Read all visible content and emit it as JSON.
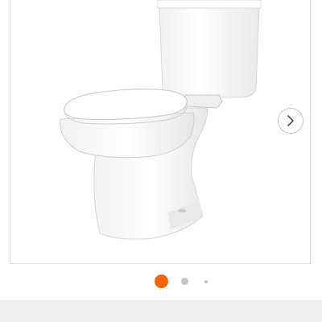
{
  "gallery": {
    "image_subject": "two-piece-toilet",
    "next_icon": "chevron-right-icon",
    "active_color": "#f96302",
    "inactive_color": "#c4c4c4",
    "dots": [
      {
        "state": "active"
      },
      {
        "state": "inactive"
      },
      {
        "state": "inactive"
      }
    ]
  }
}
